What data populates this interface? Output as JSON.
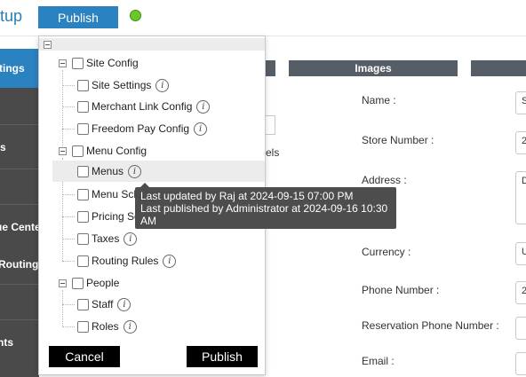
{
  "header": {
    "app_title_fragment": "tup",
    "publish_label": "Publish",
    "status": "online"
  },
  "sidebar": {
    "items": [
      {
        "label": "ttings",
        "active": true
      },
      {
        "label": "s",
        "active": false
      },
      {
        "label": "ue Cente",
        "active": false
      },
      {
        "label": "Routing",
        "active": false
      },
      {
        "label": "nts",
        "active": false
      }
    ]
  },
  "tabs": [
    {
      "label": ""
    },
    {
      "label": "Images"
    },
    {
      "label": ""
    }
  ],
  "background_text": {
    "partial_label": "els"
  },
  "form": {
    "fields": [
      {
        "label": "Name :",
        "value": "S"
      },
      {
        "label": "Store Number :",
        "value": "2"
      },
      {
        "label": "Address :",
        "value": "D"
      },
      {
        "label": "Currency :",
        "value": "U"
      },
      {
        "label": "Phone Number :",
        "value": "2"
      },
      {
        "label": "Reservation Phone Number :",
        "value": ""
      },
      {
        "label": "Email :",
        "value": ""
      }
    ]
  },
  "publish_popup": {
    "groups": [
      {
        "label": "Site Config",
        "items": [
          {
            "label": "Site Settings",
            "info": true
          },
          {
            "label": "Merchant Link Config",
            "info": true
          },
          {
            "label": "Freedom Pay Config",
            "info": true
          }
        ]
      },
      {
        "label": "Menu Config",
        "items": [
          {
            "label": "Menus",
            "info": true
          },
          {
            "label": "Menu Sch",
            "info": false
          },
          {
            "label": "Pricing Sc",
            "info": false
          },
          {
            "label": "Taxes",
            "info": true
          },
          {
            "label": "Routing Rules",
            "info": true
          }
        ]
      },
      {
        "label": "People",
        "items": [
          {
            "label": "Staff",
            "info": true
          },
          {
            "label": "Roles",
            "info": true
          }
        ]
      }
    ],
    "info_glyph": "i",
    "cancel_label": "Cancel",
    "publish_label": "Publish",
    "tooltip": {
      "line1": "Last updated by Raj at 2024-09-15 07:00 PM",
      "line2": "Last published by Administrator at 2024-09-16 10:30",
      "line3": "AM"
    }
  },
  "colors": {
    "accent": "#2b82c1",
    "sidebar": "#4a4a4a",
    "tab": "#555d66",
    "status": "#6cc72a"
  }
}
